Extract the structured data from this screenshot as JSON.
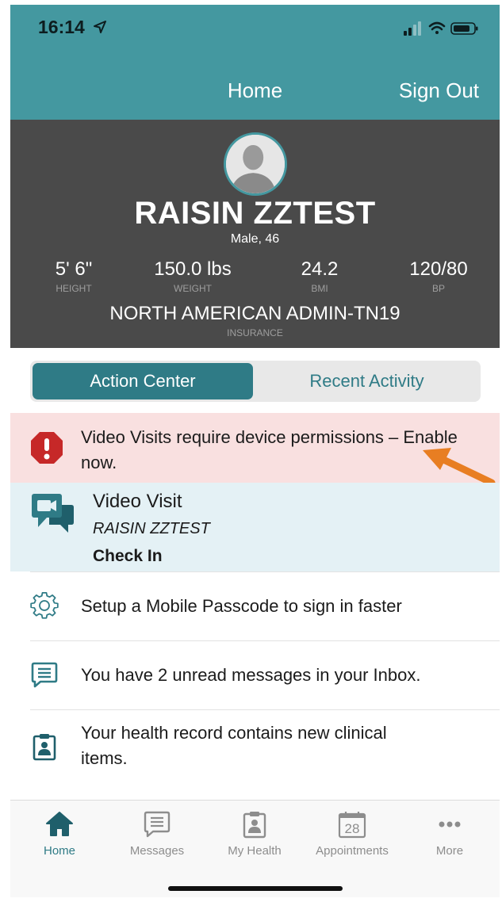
{
  "status_bar": {
    "time": "16:14"
  },
  "nav": {
    "title": "Home",
    "sign_out": "Sign Out"
  },
  "profile": {
    "name": "RAISIN ZZTEST",
    "subtitle": "Male, 46",
    "stats": [
      {
        "value": "5' 6\"",
        "label": "HEIGHT"
      },
      {
        "value": "150.0 lbs",
        "label": "WEIGHT"
      },
      {
        "value": "24.2",
        "label": "BMI"
      },
      {
        "value": "120/80",
        "label": "BP"
      }
    ],
    "insurance": {
      "value": "NORTH AMERICAN ADMIN-TN19",
      "label": "INSURANCE"
    }
  },
  "segments": {
    "active": "Action Center",
    "inactive": "Recent Activity"
  },
  "alert": {
    "text": "Video Visits require device permissions – Enable now."
  },
  "video_visit": {
    "title": "Video Visit",
    "patient": "RAISIN ZZTEST",
    "action": "Check In"
  },
  "action_items": [
    {
      "text": "Setup a Mobile Passcode to sign in faster",
      "icon": "gear-icon"
    },
    {
      "text": "You have 2 unread messages in your Inbox.",
      "icon": "message-icon"
    },
    {
      "text": "Your health record contains new clinical items.",
      "icon": "health-record-icon"
    }
  ],
  "tabs": [
    {
      "label": "Home",
      "icon": "home-icon",
      "active": true
    },
    {
      "label": "Messages",
      "icon": "messages-icon",
      "active": false
    },
    {
      "label": "My Health",
      "icon": "my-health-icon",
      "active": false
    },
    {
      "label": "Appointments",
      "icon": "calendar-icon",
      "active": false,
      "badge": "28"
    },
    {
      "label": "More",
      "icon": "more-icon",
      "active": false
    }
  ],
  "colors": {
    "header_teal": "#4498a0",
    "accent_teal": "#2f7b86",
    "profile_bg": "#4a4a4a",
    "alert_bg": "#f9e0e0",
    "alert_red": "#c62828",
    "visit_bg": "#e4f1f5",
    "annotation_orange": "#e87e22"
  }
}
